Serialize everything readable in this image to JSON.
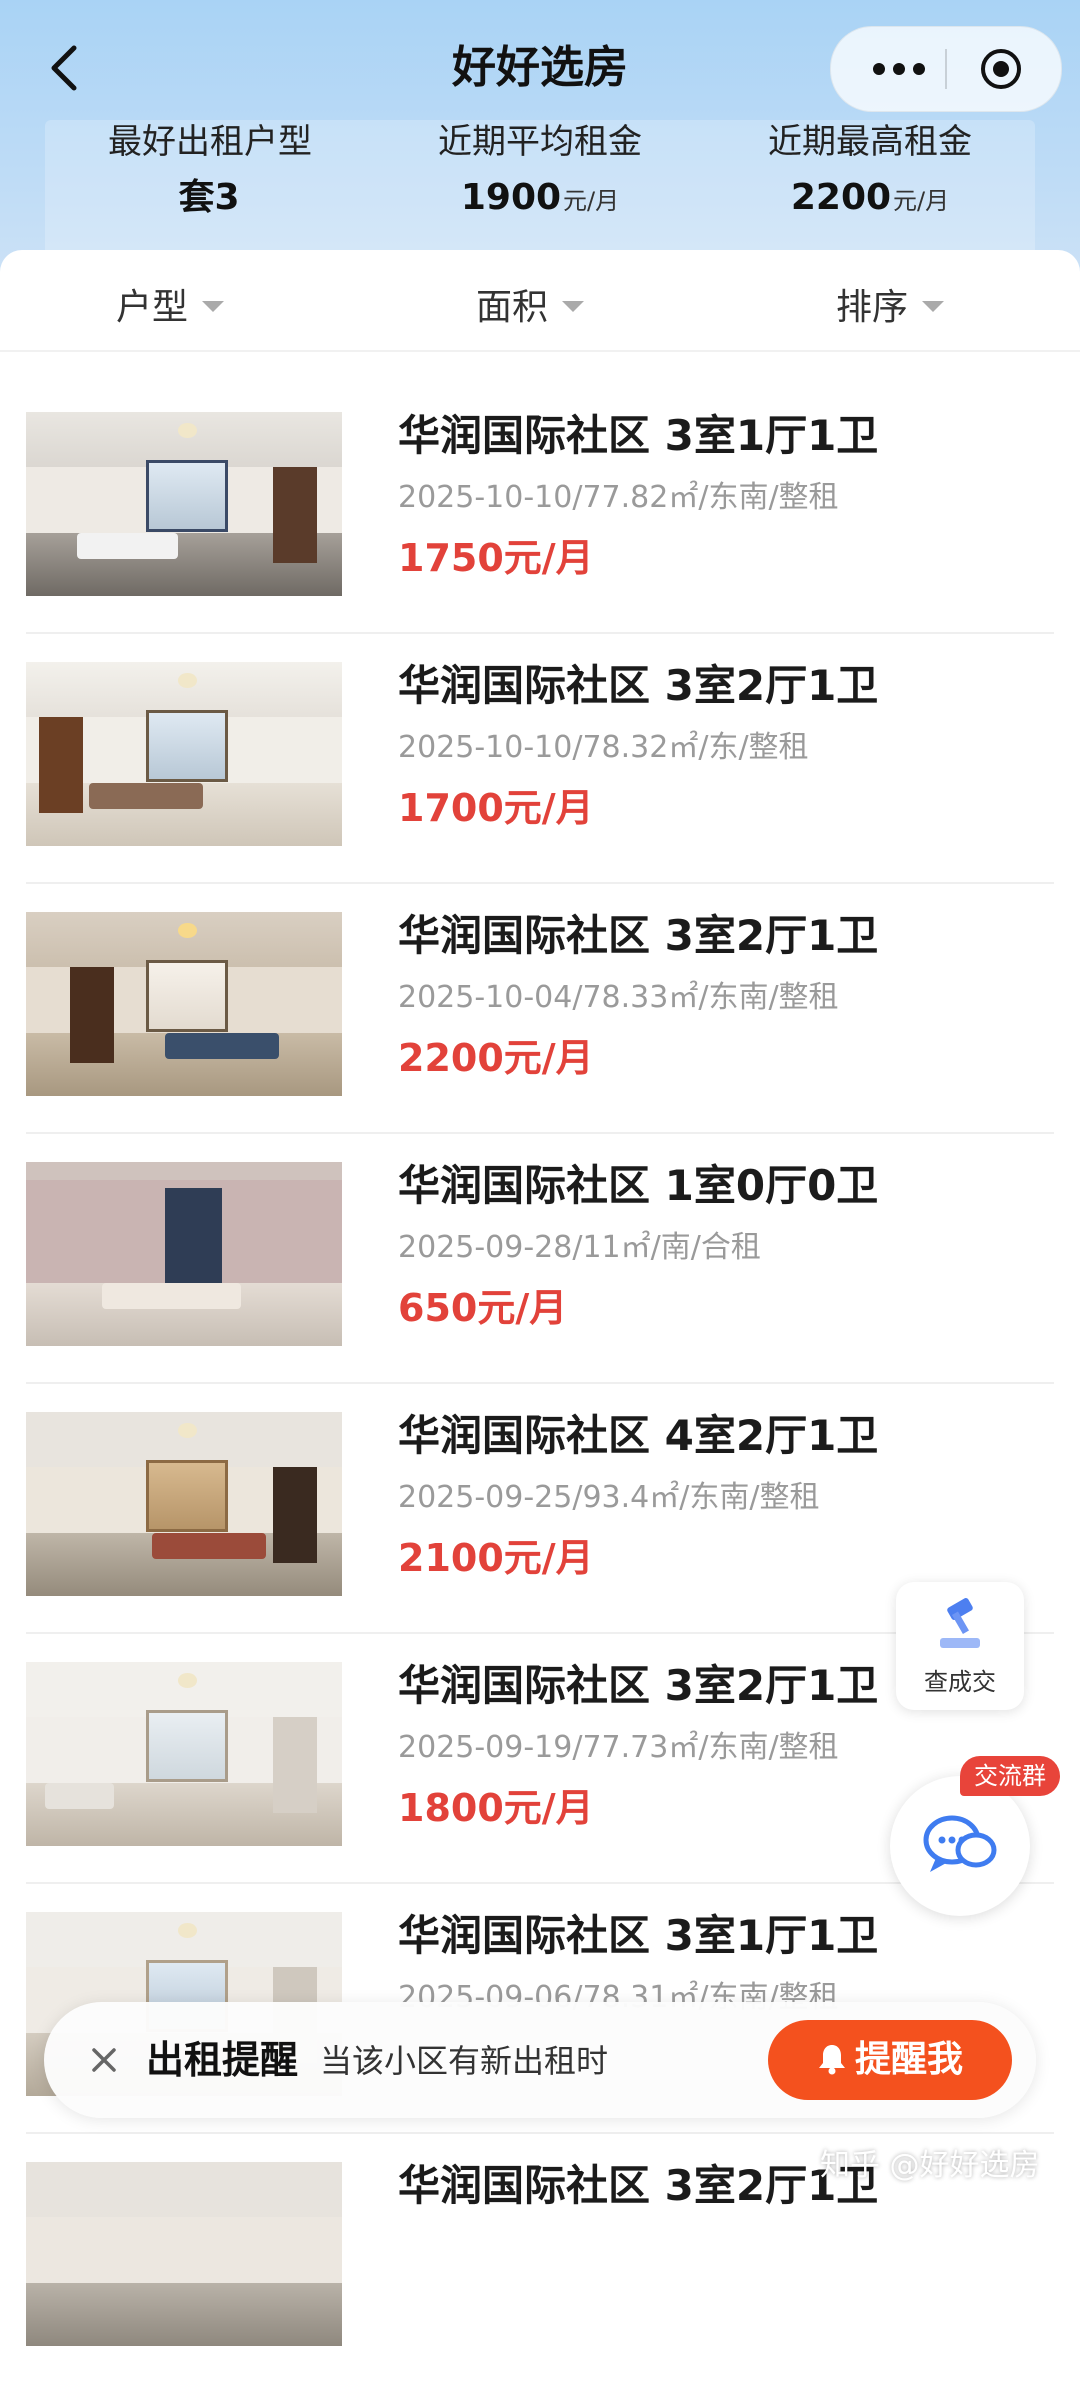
{
  "header": {
    "title": "好好选房",
    "stats": [
      {
        "label": "最好出租户型",
        "value": "套3",
        "unit": ""
      },
      {
        "label": "近期平均租金",
        "value": "1900",
        "unit": "元/月"
      },
      {
        "label": "近期最高租金",
        "value": "2200",
        "unit": "元/月"
      }
    ]
  },
  "filters": [
    {
      "label": "户型"
    },
    {
      "label": "面积"
    },
    {
      "label": "排序"
    }
  ],
  "listings": [
    {
      "title": "华润国际社区 3室1厅1卫",
      "meta": "2025-10-10/77.82㎡/东南/整租",
      "price": "1750元/月"
    },
    {
      "title": "华润国际社区 3室2厅1卫",
      "meta": "2025-10-10/78.32㎡/东/整租",
      "price": "1700元/月"
    },
    {
      "title": "华润国际社区 3室2厅1卫",
      "meta": "2025-10-04/78.33㎡/东南/整租",
      "price": "2200元/月"
    },
    {
      "title": "华润国际社区 1室0厅0卫",
      "meta": "2025-09-28/11㎡/南/合租",
      "price": "650元/月"
    },
    {
      "title": "华润国际社区 4室2厅1卫",
      "meta": "2025-09-25/93.4㎡/东南/整租",
      "price": "2100元/月"
    },
    {
      "title": "华润国际社区 3室2厅1卫",
      "meta": "2025-09-19/77.73㎡/东南/整租",
      "price": "1800元/月"
    },
    {
      "title": "华润国际社区 3室1厅1卫",
      "meta": "2025-09-06/78.31㎡/东南/整租",
      "price": ""
    },
    {
      "title": "华润国际社区 3室2厅1卫",
      "meta": "",
      "price": ""
    }
  ],
  "floating": {
    "deal_label": "查成交",
    "chat_badge": "交流群"
  },
  "reminder": {
    "title": "出租提醒",
    "description": "当该小区有新出租时",
    "button": "提醒我"
  },
  "watermark": "知乎 @好好选房",
  "colors": {
    "price": "#e2423a",
    "reminder_button": "#f4511e",
    "header_bg": "#a9d3f5"
  }
}
